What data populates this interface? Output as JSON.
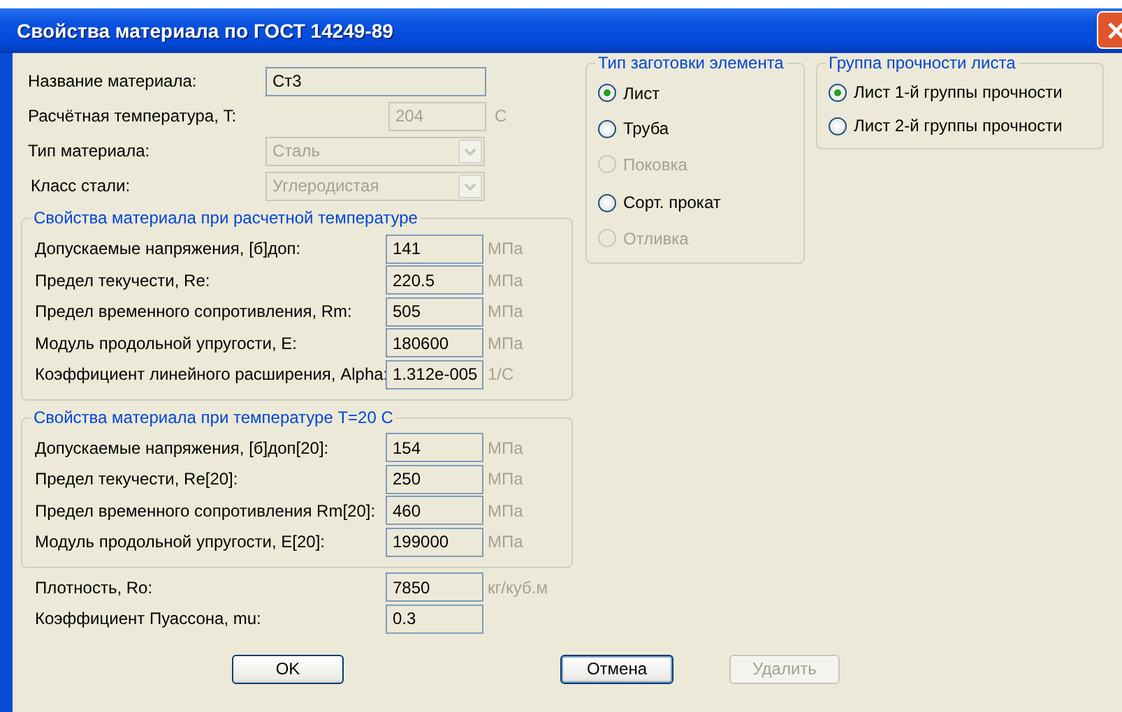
{
  "window": {
    "title": "Свойства материала по ГОСТ 14249-89"
  },
  "fields": [
    {
      "kind": "text",
      "label": "Название материала:",
      "value": "Ст3",
      "disabled": false
    },
    {
      "kind": "short",
      "label": "Расчётная температура, T:",
      "value": "204",
      "unit": "C",
      "disabled": true
    },
    {
      "kind": "select",
      "label": "Тип материала:",
      "value": "Сталь",
      "disabled": true
    },
    {
      "kind": "select",
      "label": "Класс стали:",
      "value": "Углеродистая",
      "disabled": true
    }
  ],
  "groups": [
    {
      "title": "Свойства материала при расчетной температуре",
      "rows": [
        {
          "label": "Допускаемые напряжения, [б]доп:",
          "value": "141",
          "unit": "МПа"
        },
        {
          "label": "Предел текучести, Re:",
          "value": "220.5",
          "unit": "МПа"
        },
        {
          "label": "Предел временного сопротивления, Rm:",
          "value": "505",
          "unit": "МПа"
        },
        {
          "label": "Модуль продольной упругости, E:",
          "value": "180600",
          "unit": "МПа"
        },
        {
          "label": "Коэффициент линейного расширения, Alpha:",
          "value": "1.312e-005",
          "unit": "1/C"
        }
      ]
    },
    {
      "title": "Свойства материала при температуре T=20 C",
      "rows": [
        {
          "label": "Допускаемые напряжения, [б]доп[20]:",
          "value": "154",
          "unit": "МПа"
        },
        {
          "label": "Предел текучести, Re[20]:",
          "value": "250",
          "unit": "МПа"
        },
        {
          "label": "Предел временного сопротивления Rm[20]:",
          "value": "460",
          "unit": "МПа"
        },
        {
          "label": "Модуль продольной упругости, E[20]:",
          "value": "199000",
          "unit": "МПа"
        }
      ]
    }
  ],
  "extra_rows": [
    {
      "label": "Плотность, Ro:",
      "value": "7850",
      "unit": "кг/куб.м"
    },
    {
      "label": "Коэффициент Пуассона, mu:",
      "value": "0.3"
    }
  ],
  "blank_type": {
    "title": "Тип заготовки элемента",
    "options": [
      {
        "label": "Лист",
        "selected": true,
        "disabled": false
      },
      {
        "label": "Труба",
        "selected": false,
        "disabled": false
      },
      {
        "label": "Поковка",
        "selected": false,
        "disabled": true
      },
      {
        "label": "Сорт. прокат",
        "selected": false,
        "disabled": false
      },
      {
        "label": "Отливка",
        "selected": false,
        "disabled": true
      }
    ]
  },
  "strength_group": {
    "title": "Группа прочности листа",
    "options": [
      {
        "label": "Лист 1-й группы прочности",
        "selected": true,
        "disabled": false
      },
      {
        "label": "Лист 2-й группы прочности",
        "selected": false,
        "disabled": false
      }
    ]
  },
  "buttons": [
    {
      "label": "OK",
      "disabled": false,
      "focused": false
    },
    {
      "label": "Отмена",
      "disabled": false,
      "focused": true
    },
    {
      "label": "Удалить",
      "disabled": true,
      "focused": false
    }
  ]
}
